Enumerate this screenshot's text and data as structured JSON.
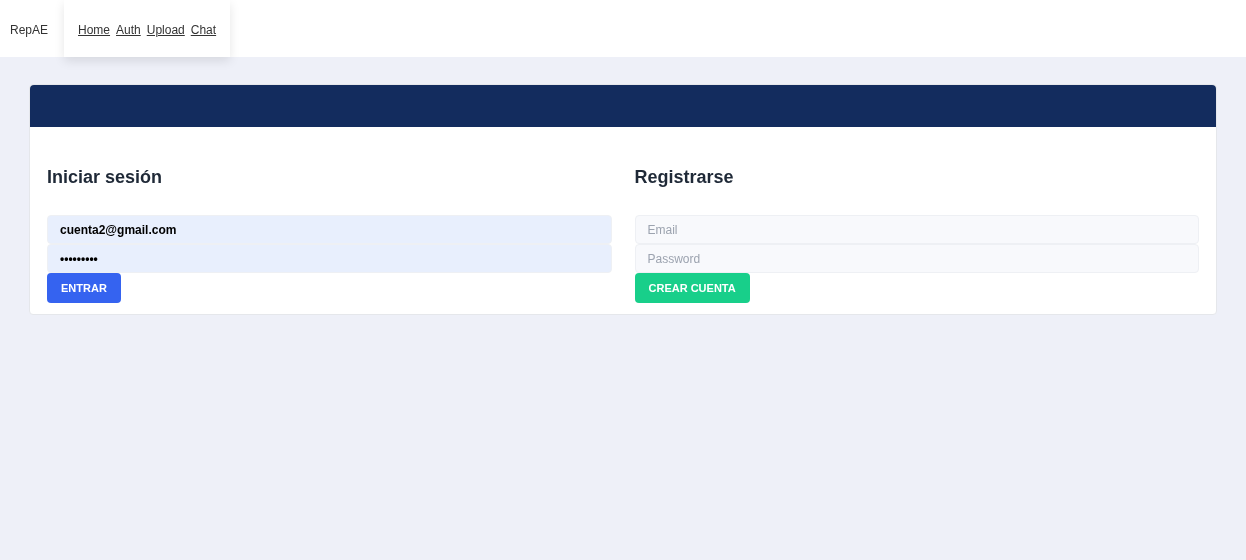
{
  "brand": "RepAE",
  "nav": [
    {
      "label": "Home"
    },
    {
      "label": "Auth"
    },
    {
      "label": "Upload"
    },
    {
      "label": "Chat"
    }
  ],
  "login": {
    "title": "Iniciar sesión",
    "fields": [
      {
        "value": "cuenta2@gmail.com"
      },
      {
        "value": "•••••••••"
      }
    ],
    "button": "ENTRAR"
  },
  "register": {
    "title": "Registrarse",
    "fields": [
      {
        "placeholder": "Email"
      },
      {
        "placeholder": "Password"
      }
    ],
    "button": "CREAR CUENTA"
  }
}
